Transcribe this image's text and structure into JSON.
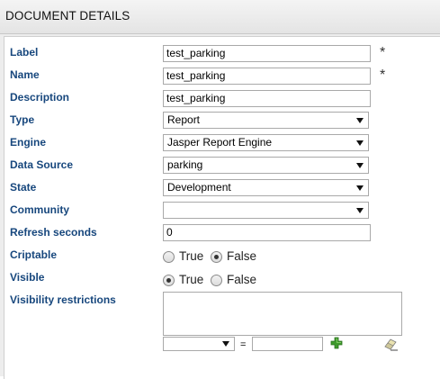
{
  "header": {
    "title": "DOCUMENT DETAILS"
  },
  "fields": {
    "label": {
      "label": "Label",
      "value": "test_parking",
      "required_mark": "*"
    },
    "name": {
      "label": "Name",
      "value": "test_parking",
      "required_mark": "*"
    },
    "description": {
      "label": "Description",
      "value": "test_parking"
    },
    "type": {
      "label": "Type",
      "value": "Report"
    },
    "engine": {
      "label": "Engine",
      "value": "Jasper Report Engine"
    },
    "data_source": {
      "label": "Data Source",
      "value": "parking"
    },
    "state": {
      "label": "State",
      "value": "Development"
    },
    "community": {
      "label": "Community",
      "value": ""
    },
    "refresh_seconds": {
      "label": "Refresh seconds",
      "value": "0"
    },
    "criptable": {
      "label": "Criptable",
      "true_label": "True",
      "false_label": "False",
      "selected": "False"
    },
    "visible": {
      "label": "Visible",
      "true_label": "True",
      "false_label": "False",
      "selected": "True"
    },
    "visibility_restrictions": {
      "label": "Visibility restrictions",
      "value": "",
      "equals": "="
    }
  },
  "icons": {
    "add": "add-icon",
    "erase": "eraser-icon"
  },
  "colors": {
    "label_text": "#17477d",
    "header_bg": "#e9e9e9",
    "add_icon": "#3e9a2c"
  }
}
